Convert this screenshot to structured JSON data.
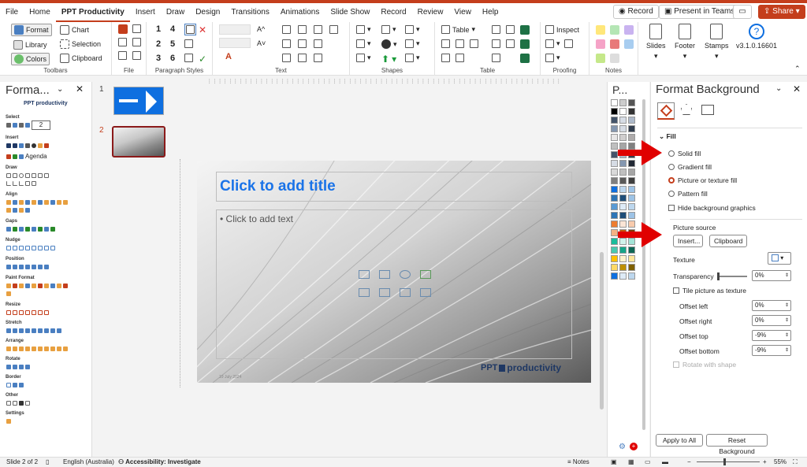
{
  "menu": {
    "tabs": [
      "File",
      "Home",
      "PPT Productivity",
      "Insert",
      "Draw",
      "Design",
      "Transitions",
      "Animations",
      "Slide Show",
      "Record",
      "Review",
      "View",
      "Help"
    ],
    "active": "PPT Productivity",
    "record_label": "Record",
    "present_label": "Present in Teams",
    "share_label": "Share"
  },
  "ribbon": {
    "toolbars": {
      "format": "Format",
      "library": "Library",
      "colors": "Colors",
      "label": "Toolbars"
    },
    "file": {
      "chart": "Chart",
      "selection": "Selection",
      "clipboard": "Clipboard",
      "label": "File"
    },
    "paragraph": {
      "label": "Paragraph Styles",
      "nums": [
        "1",
        "2",
        "3",
        "4",
        "5",
        "6"
      ]
    },
    "text_label": "Text",
    "shapes_label": "Shapes",
    "table": {
      "label": "Table",
      "table_btn": "Table"
    },
    "proofing": {
      "inspect": "Inspect",
      "label": "Proofing"
    },
    "notes_label": "Notes",
    "slides_label": "Slides",
    "footer_label": "Footer",
    "stamps_label": "Stamps",
    "version": "v3.1.0.16601"
  },
  "format_pane": {
    "title": "Forma...",
    "logo": "PPT productivity",
    "spin_value": "2",
    "agenda": "Agenda",
    "sections": [
      "Select",
      "Insert",
      "Draw",
      "Align",
      "Gaps",
      "Nudge",
      "Position",
      "Paint Format",
      "Resize",
      "Stretch",
      "Arrange",
      "Rotate",
      "Border",
      "Other",
      "Settings"
    ]
  },
  "thumbnails": {
    "items": [
      "1",
      "2"
    ]
  },
  "slide": {
    "title_placeholder": "Click to add title",
    "text_placeholder": "Click to add text",
    "date": "19 July 2024",
    "logo": "productivity",
    "logo_prefix": "PPT"
  },
  "palette": {
    "title": "P..."
  },
  "format_background": {
    "title": "Format Background",
    "fill_label": "Fill",
    "options": [
      "Solid fill",
      "Gradient fill",
      "Picture or texture fill",
      "Pattern fill"
    ],
    "selected": "Picture or texture fill",
    "hide_bg": "Hide background graphics",
    "picture_source": "Picture source",
    "insert": "Insert...",
    "clipboard": "Clipboard",
    "texture": "Texture",
    "transparency": "Transparency",
    "transparency_value": "0%",
    "tile": "Tile picture as texture",
    "offset_left": "Offset left",
    "offset_left_value": "0%",
    "offset_right": "Offset right",
    "offset_right_value": "0%",
    "offset_top": "Offset top",
    "offset_top_value": "-9%",
    "offset_bottom": "Offset bottom",
    "offset_bottom_value": "-9%",
    "rotate": "Rotate with shape",
    "apply_all": "Apply to All",
    "reset": "Reset Background"
  },
  "status": {
    "slide": "Slide 2 of 2",
    "language": "English (Australia)",
    "accessibility": "Accessibility: Investigate",
    "notes": "Notes",
    "zoom": "55%"
  },
  "colors": {
    "accent": "#c43e1c",
    "blue": "#0e6fe0",
    "title_blue": "#1a73e8",
    "arrow_red": "#e00000"
  }
}
